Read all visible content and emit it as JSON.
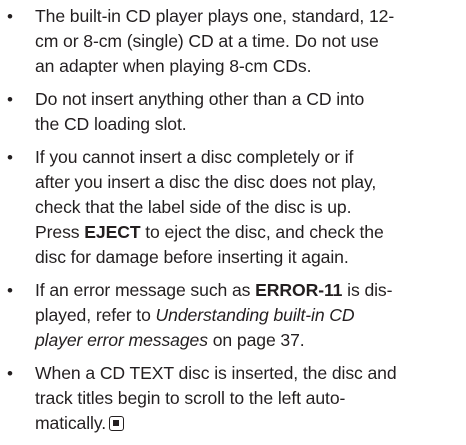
{
  "bullets": [
    {
      "lines": [
        "The built-in CD player plays one, standard, 12-",
        "cm or 8-cm (single) CD at a time. Do not use",
        "an adapter when playing 8-cm CDs."
      ]
    },
    {
      "lines": [
        "Do not insert anything other than a CD into",
        "the CD loading slot."
      ]
    },
    {
      "lines": [
        "If you cannot insert a disc completely or if",
        "after you insert a disc the disc does not play,",
        "check that the label side of the disc is up."
      ],
      "line4_pre": "Press ",
      "line4_bold": "EJECT",
      "line4_post": " to eject the disc, and check the",
      "line5": "disc for damage before inserting it again."
    },
    {
      "line1_pre": "If an error message such as ",
      "line1_bold": "ERROR-11",
      "line1_post": " is dis-",
      "line2_pre": "played, refer to ",
      "line2_italic": "Understanding built-in CD",
      "line3_italic": "player error messages",
      "line3_post": " on page 37."
    },
    {
      "lines": [
        "When a CD TEXT disc is inserted, the disc and",
        "track titles begin to scroll to the left auto-",
        "matically."
      ]
    }
  ],
  "bullet_glyph": "•",
  "end_icon": "end-of-section-icon"
}
